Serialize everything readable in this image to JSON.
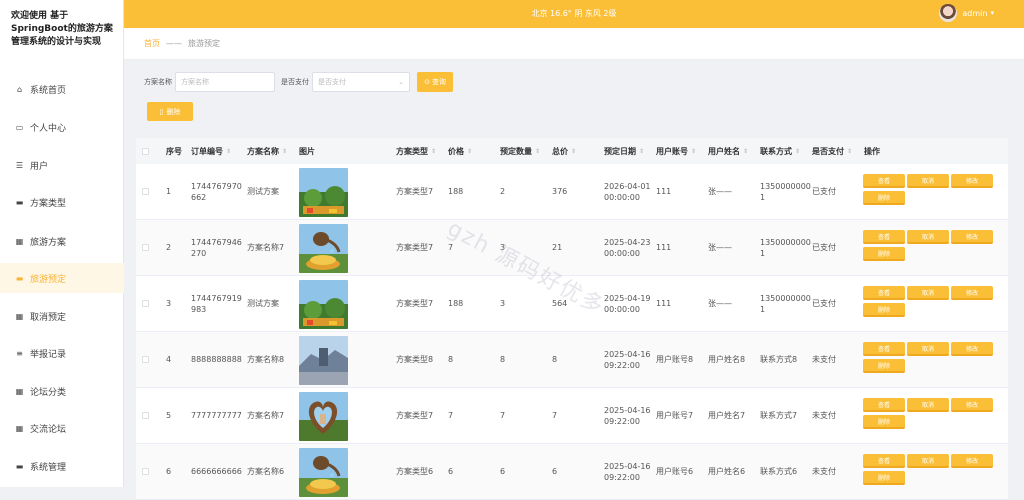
{
  "sidebar": {
    "title": "欢迎使用 基于SpringBoot的旅游方案管理系统的设计与实现",
    "items": [
      {
        "label": "系统首页",
        "icon": "home-icon",
        "glyph": "⌂"
      },
      {
        "label": "个人中心",
        "icon": "id-card-icon",
        "glyph": "▭"
      },
      {
        "label": "用户",
        "icon": "sliders-icon",
        "glyph": "☰"
      },
      {
        "label": "方案类型",
        "icon": "comment-icon",
        "glyph": "▬"
      },
      {
        "label": "旅游方案",
        "icon": "grid-icon",
        "glyph": "▦"
      },
      {
        "label": "旅游预定",
        "icon": "ticket-icon",
        "glyph": "▬"
      },
      {
        "label": "取消预定",
        "icon": "grid-icon",
        "glyph": "▦"
      },
      {
        "label": "举报记录",
        "icon": "list-icon",
        "glyph": "≡"
      },
      {
        "label": "论坛分类",
        "icon": "grid-icon",
        "glyph": "▦"
      },
      {
        "label": "交流论坛",
        "icon": "grid-icon",
        "glyph": "▦"
      },
      {
        "label": "系统管理",
        "icon": "monitor-icon",
        "glyph": "▬"
      }
    ],
    "active_index": 5
  },
  "topbar": {
    "weather": "北京  16.6°  阴  东风  2级",
    "username": "admin",
    "caret": "▾"
  },
  "breadcrumb": {
    "home": "首页",
    "sep": "——",
    "current": "旅游预定"
  },
  "filters": {
    "name_label": "方案名称",
    "name_placeholder": "方案名称",
    "paid_label": "是否支付",
    "paid_placeholder": "是否支付",
    "search_label": "查询",
    "delete_label": "删除"
  },
  "table": {
    "headers": [
      "序号",
      "订单编号",
      "方案名称",
      "图片",
      "方案类型",
      "价格",
      "预定数量",
      "总价",
      "预定日期",
      "用户账号",
      "用户姓名",
      "联系方式",
      "是否支付",
      "操作"
    ],
    "ops": [
      "查看",
      "取消",
      "修改",
      "删除"
    ],
    "rows": [
      {
        "no": "1",
        "order": "1744767970662",
        "name": "测试方案",
        "type": "方案类型7",
        "price": "188",
        "qty": "2",
        "total": "376",
        "date": "2026-04-01 00:00:00",
        "account": "111",
        "uname": "张——",
        "phone": "13500000001",
        "paid": "已支付",
        "img": "garden"
      },
      {
        "no": "2",
        "order": "1744767946270",
        "name": "方案名称7",
        "type": "方案类型7",
        "price": "7",
        "qty": "3",
        "total": "21",
        "date": "2025-04-23 00:00:00",
        "account": "111",
        "uname": "张——",
        "phone": "13500000001",
        "paid": "已支付",
        "img": "teapot"
      },
      {
        "no": "3",
        "order": "1744767919983",
        "name": "测试方案",
        "type": "方案类型7",
        "price": "188",
        "qty": "3",
        "total": "564",
        "date": "2025-04-19 00:00:00",
        "account": "111",
        "uname": "张——",
        "phone": "13500000001",
        "paid": "已支付",
        "img": "garden"
      },
      {
        "no": "4",
        "order": "8888888888",
        "name": "方案名称8",
        "type": "方案类型8",
        "price": "8",
        "qty": "8",
        "total": "8",
        "date": "2025-04-16 09:22:00",
        "account": "用户账号8",
        "uname": "用户姓名8",
        "phone": "联系方式8",
        "paid": "未支付",
        "img": "wall"
      },
      {
        "no": "5",
        "order": "7777777777",
        "name": "方案名称7",
        "type": "方案类型7",
        "price": "7",
        "qty": "7",
        "total": "7",
        "date": "2025-04-16 09:22:00",
        "account": "用户账号7",
        "uname": "用户姓名7",
        "phone": "联系方式7",
        "paid": "未支付",
        "img": "heart"
      },
      {
        "no": "6",
        "order": "6666666666",
        "name": "方案名称6",
        "type": "方案类型6",
        "price": "6",
        "qty": "6",
        "total": "6",
        "date": "2025-04-16 09:22:00",
        "account": "用户账号6",
        "uname": "用户姓名6",
        "phone": "联系方式6",
        "paid": "未支付",
        "img": "teapot"
      }
    ]
  },
  "watermark": "gzh 源码好优多",
  "colors": {
    "accent": "#fbbf37",
    "active_bg": "#fff7e6"
  }
}
